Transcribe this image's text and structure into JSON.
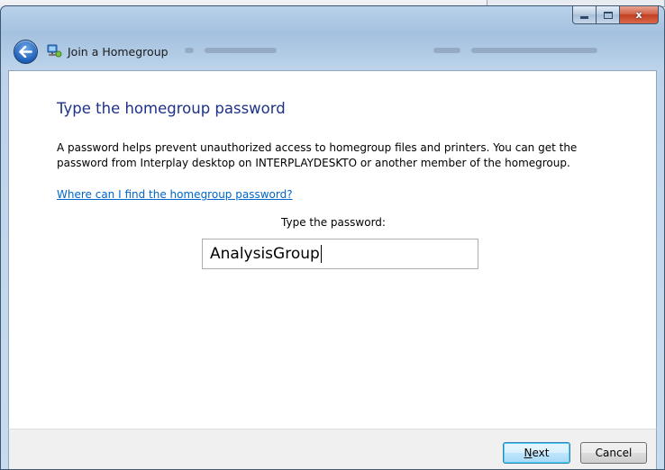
{
  "window": {
    "title": "Join a Homegroup",
    "caption_buttons": {
      "minimize_icon": "minimize-icon",
      "maximize_icon": "maximize-icon",
      "close_label": "x"
    }
  },
  "navigation": {
    "back_icon": "back-arrow-icon",
    "app_icon": "homegroup-icon"
  },
  "content": {
    "heading": "Type the homegroup password",
    "description": "A password helps prevent unauthorized access to homegroup files and printers. You can get the password from Interplay desktop on INTERPLAYDESKTO or another member of the homegroup.",
    "help_link": "Where can I find the homegroup password?",
    "password_label": "Type the password:",
    "password_value": "AnalysisGroup"
  },
  "footer": {
    "next_mnemonic": "N",
    "next_rest": "ext",
    "cancel_label": "Cancel"
  },
  "colors": {
    "heading": "#1e3287",
    "link": "#0066cc",
    "close_button": "#c23f22"
  }
}
